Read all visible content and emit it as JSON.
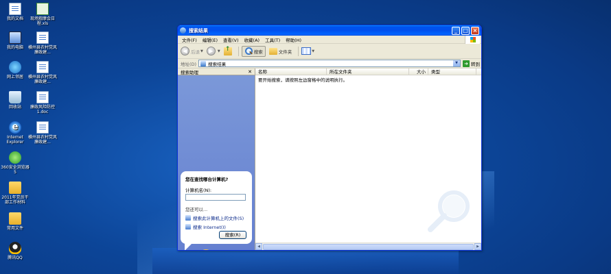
{
  "desktop": {
    "icons": [
      {
        "label": "我的文档",
        "icon": "my-documents-icon"
      },
      {
        "label": "我的电脑",
        "icon": "my-computer-icon"
      },
      {
        "label": "网上邻居",
        "icon": "network-places-icon"
      },
      {
        "label": "回收站",
        "icon": "recycle-bin-icon"
      },
      {
        "label": "Internet Explorer",
        "icon": "ie-icon"
      },
      {
        "label": "360安全浏览器 5",
        "icon": "browser-360-icon"
      },
      {
        "label": "2011年党员干部工作材料",
        "icon": "folder-icon"
      },
      {
        "label": "常用文件",
        "icon": "folder-icon"
      },
      {
        "label": "腾讯QQ",
        "icon": "qq-icon"
      },
      {
        "label": "现场观摩会日程.xls",
        "icon": "excel-file-icon"
      },
      {
        "label": "横州县农村党风廉政建...",
        "icon": "word-file-icon"
      },
      {
        "label": "横州县农村党风廉政建...",
        "icon": "word-file-icon"
      },
      {
        "label": "廉政风险防控1.doc",
        "icon": "word-file-icon"
      },
      {
        "label": "横州县农村党风廉政建...",
        "icon": "word-file-icon"
      }
    ]
  },
  "window": {
    "title": "搜索结果",
    "menu": [
      "文件(F)",
      "编辑(E)",
      "查看(V)",
      "收藏(A)",
      "工具(T)",
      "帮助(H)"
    ],
    "toolbar": {
      "back": "后退",
      "search": "搜索",
      "folders": "文件夹"
    },
    "address": {
      "label": "地址(D)",
      "value": "搜索结果",
      "go": "转到"
    },
    "left_pane": {
      "title": "搜索助理",
      "question": "您在查找哪台计算机?",
      "computer_name_label": "计算机名(N):",
      "computer_name_value": "",
      "also_label": "您还可以...",
      "link_files": "搜索此计算机上的文件(S)",
      "link_internet": "搜索 Internet(I)",
      "search_button": "搜索(R)"
    },
    "columns": [
      "名称",
      "所在文件夹",
      "大小",
      "类型"
    ],
    "message": "要开始搜索，请按照左边窗格中的说明执行。"
  }
}
